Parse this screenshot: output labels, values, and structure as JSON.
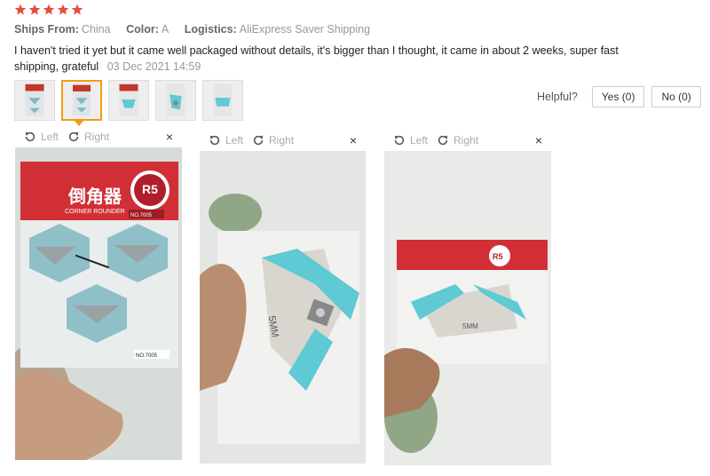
{
  "rating": {
    "stars": 5,
    "color": "#e74c3c"
  },
  "meta": {
    "ships_from_label": "Ships From:",
    "ships_from_value": "China",
    "color_label": "Color:",
    "color_value": "A",
    "logistics_label": "Logistics:",
    "logistics_value": "AliExpress Saver Shipping"
  },
  "review": {
    "text": "I haven't tried it yet but it came well packaged without details, it's bigger than I thought, it came in about 2 weeks, super fast shipping, grateful",
    "date": "03 Dec 2021 14:59"
  },
  "helpful": {
    "label": "Helpful?",
    "yes": "Yes (0)",
    "no": "No (0)"
  },
  "viewer": {
    "left": "Left",
    "right": "Right",
    "close": "×"
  },
  "package": {
    "brand_cn": "倒角器",
    "brand_en": "CORNER ROUNDER",
    "badge": "R5",
    "badge_sub": "5mm",
    "model": "NO.7005",
    "blade_label": "5MM"
  },
  "thumbnails": {
    "count": 5,
    "selected": 2
  }
}
